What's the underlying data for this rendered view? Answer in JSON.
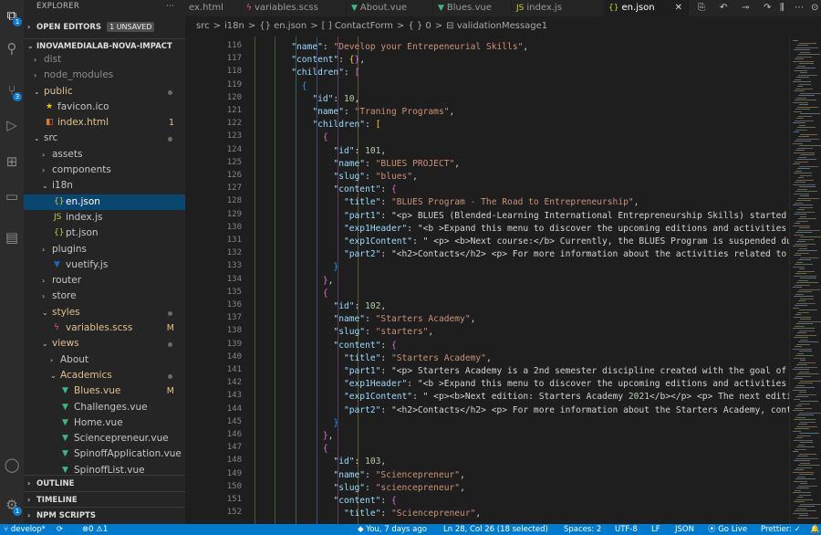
{
  "activity_bar": {
    "scm_badge": "3",
    "explorer_badge": "1",
    "settings_badge": "1"
  },
  "explorer": {
    "title": "EXPLORER",
    "more": "···",
    "open_editors": {
      "label": "OPEN EDITORS",
      "unsaved": "1 UNSAVED"
    },
    "project": "INOVAMEDIALAB-NOVA-IMPACT",
    "tree": [
      {
        "label": "dist",
        "type": "folder",
        "depth": 1,
        "open": false,
        "dim": true
      },
      {
        "label": "node_modules",
        "type": "folder",
        "depth": 1,
        "open": false,
        "dim": true
      },
      {
        "label": "public",
        "type": "folder",
        "depth": 1,
        "open": true,
        "color": "#e2c08d",
        "dot": true
      },
      {
        "label": "favicon.ico",
        "type": "star",
        "depth": 2
      },
      {
        "label": "index.html",
        "type": "html",
        "depth": 2,
        "color": "#e2c08d",
        "status": "1"
      },
      {
        "label": "src",
        "type": "folder",
        "depth": 1,
        "open": true,
        "dot": true
      },
      {
        "label": "assets",
        "type": "folder",
        "depth": 2,
        "open": false
      },
      {
        "label": "components",
        "type": "folder",
        "depth": 2,
        "open": false
      },
      {
        "label": "i18n",
        "type": "folder",
        "depth": 2,
        "open": true
      },
      {
        "label": "en.json",
        "type": "json",
        "depth": 3,
        "selected": true
      },
      {
        "label": "index.js",
        "type": "js",
        "depth": 3
      },
      {
        "label": "pt.json",
        "type": "json",
        "depth": 3
      },
      {
        "label": "plugins",
        "type": "folder",
        "depth": 2,
        "open": false
      },
      {
        "label": "vuetify.js",
        "type": "vuetify",
        "depth": 3
      },
      {
        "label": "router",
        "type": "folder",
        "depth": 2,
        "open": false
      },
      {
        "label": "store",
        "type": "folder",
        "depth": 2,
        "open": false
      },
      {
        "label": "styles",
        "type": "folder",
        "depth": 2,
        "open": true,
        "color": "#e2c08d",
        "dot": true
      },
      {
        "label": "variables.scss",
        "type": "scss",
        "depth": 3,
        "color": "#e2c08d",
        "status": "M"
      },
      {
        "label": "views",
        "type": "folder",
        "depth": 2,
        "open": true,
        "color": "#e2c08d",
        "dot": true
      },
      {
        "label": "About",
        "type": "folder",
        "depth": 3,
        "open": false
      },
      {
        "label": "Academics",
        "type": "folder",
        "depth": 3,
        "open": true,
        "color": "#e2c08d",
        "dot": true
      },
      {
        "label": "Blues.vue",
        "type": "vue",
        "depth": 4,
        "color": "#e2c08d",
        "status": "M"
      },
      {
        "label": "Challenges.vue",
        "type": "vue",
        "depth": 4
      },
      {
        "label": "Home.vue",
        "type": "vue",
        "depth": 4
      },
      {
        "label": "Sciencepreneur.vue",
        "type": "vue",
        "depth": 4
      },
      {
        "label": "SpinoffApplication.vue",
        "type": "vue",
        "depth": 4
      },
      {
        "label": "SpinoffList.vue",
        "type": "vue",
        "depth": 4
      }
    ],
    "sections": [
      "OUTLINE",
      "TIMELINE",
      "NPM SCRIPTS"
    ]
  },
  "tabs": [
    {
      "label": "ex.html",
      "icon": "html"
    },
    {
      "label": "variables.scss",
      "icon": "scss"
    },
    {
      "label": "About.vue",
      "icon": "vue"
    },
    {
      "label": "Blues.vue",
      "icon": "vue"
    },
    {
      "label": "index.js",
      "icon": "js"
    },
    {
      "label": "en.json",
      "icon": "json",
      "active": true
    }
  ],
  "tab_close": "✕",
  "breadcrumb": [
    "src",
    ">",
    "i18n",
    ">",
    "{} en.json",
    ">",
    "[ ] ContactForm",
    ">",
    "{ } 0",
    ">",
    "⊟ validationMessage1"
  ],
  "code": [
    {
      "n": "116",
      "t": "        \"name\": \"Develop your Entrepeneurial Skills\","
    },
    {
      "n": "117",
      "t": "        \"content\": {},"
    },
    {
      "n": "118",
      "t": "        \"children\": ["
    },
    {
      "n": "119",
      "t": "          {"
    },
    {
      "n": "120",
      "t": "            \"id\": 10,"
    },
    {
      "n": "121",
      "t": "            \"name\": \"Traning Programs\","
    },
    {
      "n": "122",
      "t": "            \"children\": ["
    },
    {
      "n": "123",
      "t": "              {"
    },
    {
      "n": "124",
      "t": "                \"id\": 101,"
    },
    {
      "n": "125",
      "t": "                \"name\": \"BLUES PROJECT\","
    },
    {
      "n": "126",
      "t": "                \"slug\": \"blues\","
    },
    {
      "n": "127",
      "t": "                \"content\": {"
    },
    {
      "n": "128",
      "t": "                  \"title\": \"BLUES Program - The Road to Entrepreneurship\","
    },
    {
      "n": "129",
      "t": "                  \"part1\": \"<p> BLUES (Blended-Learning International Entrepreneurship Skills) started i"
    },
    {
      "n": "130",
      "t": "                  \"exp1Header\": \"<b >Expand this menu to discover the upcoming editions and activities o"
    },
    {
      "n": "131",
      "t": "                  \"exp1Content\": \" <p> <b>Next course:</b> Currently, the BLUES Program is suspended due"
    },
    {
      "n": "132",
      "t": "                  \"part2\": \"<h2>Contacts</h2> <p> For more information about the activities related to B"
    },
    {
      "n": "133",
      "t": "                }"
    },
    {
      "n": "134",
      "t": "              },"
    },
    {
      "n": "135",
      "t": "              {"
    },
    {
      "n": "136",
      "t": "                \"id\": 102,"
    },
    {
      "n": "137",
      "t": "                \"name\": \"Starters Academy\","
    },
    {
      "n": "138",
      "t": "                \"slug\": \"starters\","
    },
    {
      "n": "139",
      "t": "                \"content\": {"
    },
    {
      "n": "140",
      "t": "                  \"title\": \"Starters Academy\","
    },
    {
      "n": "141",
      "t": "                  \"part1\": \"<p> Starters Academy is a 2nd semester discipline created with the goal of s"
    },
    {
      "n": "142",
      "t": "                  \"exp1Header\": \"<b >Expand this menu to discover the upcoming editions and activities o"
    },
    {
      "n": "143",
      "t": "                  \"exp1Content\": \" <p><b>Next edition: Starters Academy 2021</b></p> <p> The next editio"
    },
    {
      "n": "144",
      "t": "                  \"part2\": \"<h2>Contacts</h2> <p> For more information about the Starters Academy, conta"
    },
    {
      "n": "145",
      "t": "                }"
    },
    {
      "n": "146",
      "t": "              },"
    },
    {
      "n": "147",
      "t": "              {"
    },
    {
      "n": "148",
      "t": "                \"id\": 103,"
    },
    {
      "n": "149",
      "t": "                \"name\": \"Sciencepreneur\","
    },
    {
      "n": "150",
      "t": "                \"slug\": \"sciencepreneur\","
    },
    {
      "n": "151",
      "t": "                \"content\": {"
    },
    {
      "n": "152",
      "t": "                  \"title\": \"Sciencepreneur\","
    }
  ],
  "status": {
    "branch": "develop*",
    "sync": "⟳",
    "problems": "⊗0 ⚠1",
    "blame": "You, 7 days ago",
    "position": "Ln 28, Col 26 (18 selected)",
    "spaces": "Spaces: 2",
    "encoding": "UTF-8",
    "eol": "LF",
    "language": "JSON",
    "golive": "Go Live",
    "prettier": "Prettier: ✓"
  },
  "colors": {
    "accent": "#007acc",
    "selection": "#094771",
    "modified": "#e2c08d"
  }
}
